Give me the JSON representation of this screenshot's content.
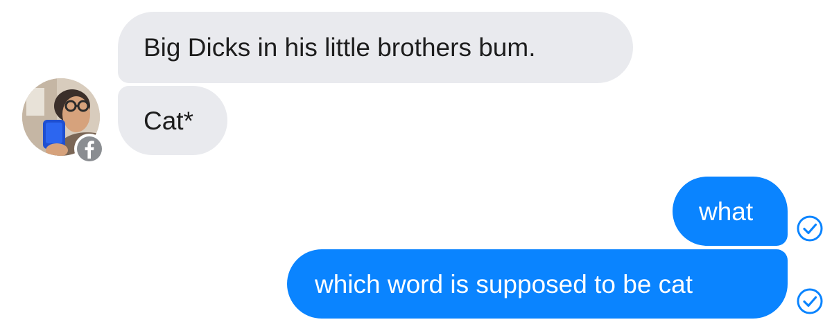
{
  "conversation": {
    "incoming": [
      {
        "text": "Big Dicks in his little brothers bum."
      },
      {
        "text": "Cat*"
      }
    ],
    "outgoing": [
      {
        "text": "what"
      },
      {
        "text": "which word is supposed to be cat"
      }
    ]
  },
  "sender": {
    "avatar_icon": "user-photo",
    "badge_icon": "facebook-icon"
  },
  "status_icon": "sent-check-icon",
  "colors": {
    "incoming_bubble": "#e9eaee",
    "outgoing_bubble": "#0a84ff",
    "status_check": "#0a84ff"
  }
}
